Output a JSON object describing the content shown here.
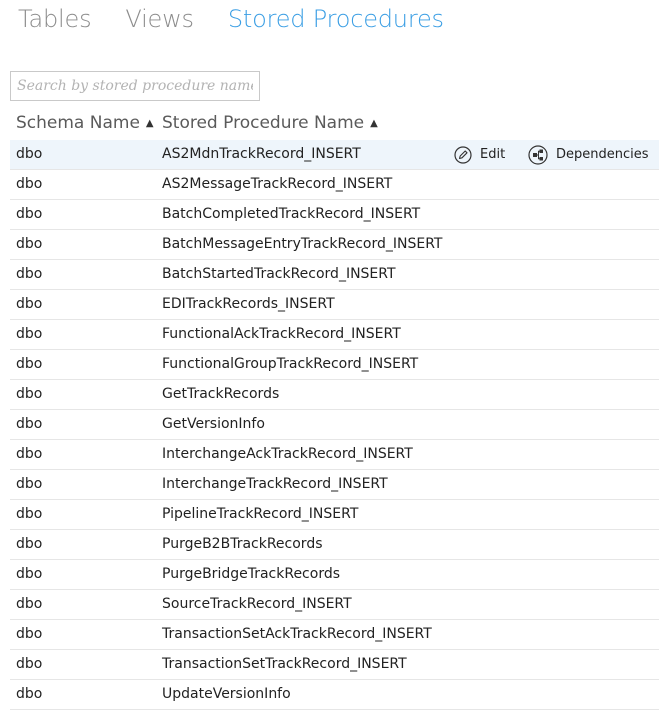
{
  "tabs": [
    {
      "label": "Tables",
      "active": false
    },
    {
      "label": "Views",
      "active": false
    },
    {
      "label": "Stored Procedures",
      "active": true
    }
  ],
  "search": {
    "placeholder": "Search by stored procedure name.",
    "value": ""
  },
  "table": {
    "columns": [
      {
        "label": "Schema Name",
        "sort": "ascending"
      },
      {
        "label": "Stored Procedure Name",
        "sort": "ascending"
      }
    ],
    "row_actions": {
      "edit_label": "Edit",
      "edit_icon": "pencil-circle-icon",
      "dependencies_label": "Dependencies",
      "dependencies_icon": "dependency-graph-icon"
    },
    "rows": [
      {
        "schema": "dbo",
        "name": "AS2MdnTrackRecord_INSERT",
        "selected": true
      },
      {
        "schema": "dbo",
        "name": "AS2MessageTrackRecord_INSERT"
      },
      {
        "schema": "dbo",
        "name": "BatchCompletedTrackRecord_INSERT"
      },
      {
        "schema": "dbo",
        "name": "BatchMessageEntryTrackRecord_INSERT"
      },
      {
        "schema": "dbo",
        "name": "BatchStartedTrackRecord_INSERT"
      },
      {
        "schema": "dbo",
        "name": "EDITrackRecords_INSERT"
      },
      {
        "schema": "dbo",
        "name": "FunctionalAckTrackRecord_INSERT"
      },
      {
        "schema": "dbo",
        "name": "FunctionalGroupTrackRecord_INSERT"
      },
      {
        "schema": "dbo",
        "name": "GetTrackRecords"
      },
      {
        "schema": "dbo",
        "name": "GetVersionInfo"
      },
      {
        "schema": "dbo",
        "name": "InterchangeAckTrackRecord_INSERT"
      },
      {
        "schema": "dbo",
        "name": "InterchangeTrackRecord_INSERT"
      },
      {
        "schema": "dbo",
        "name": "PipelineTrackRecord_INSERT"
      },
      {
        "schema": "dbo",
        "name": "PurgeB2BTrackRecords"
      },
      {
        "schema": "dbo",
        "name": "PurgeBridgeTrackRecords"
      },
      {
        "schema": "dbo",
        "name": "SourceTrackRecord_INSERT"
      },
      {
        "schema": "dbo",
        "name": "TransactionSetAckTrackRecord_INSERT"
      },
      {
        "schema": "dbo",
        "name": "TransactionSetTrackRecord_INSERT"
      },
      {
        "schema": "dbo",
        "name": "UpdateVersionInfo"
      }
    ]
  },
  "colors": {
    "active_tab": "#3a9ee4",
    "inactive_tab": "#8c8c8c",
    "selected_row": "#eef5fb",
    "row_divider": "#e6e6e6"
  }
}
